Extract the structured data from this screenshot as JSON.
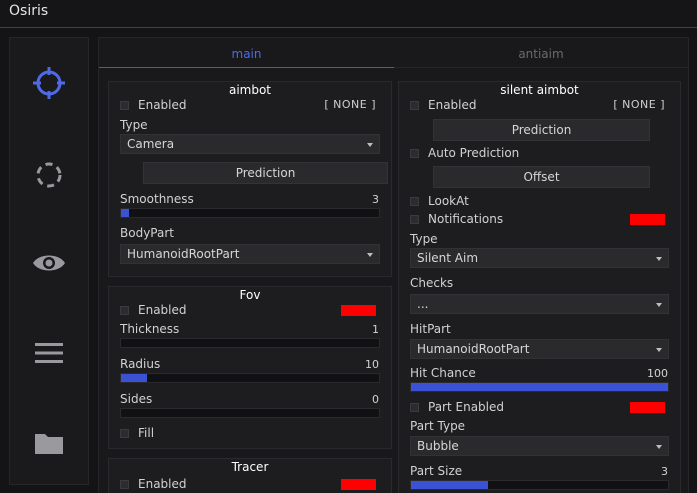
{
  "app": {
    "title": "Osiris"
  },
  "sidebar": {
    "items": [
      {
        "name": "aimbot",
        "icon": "crosshair-icon",
        "active": true
      },
      {
        "name": "loading",
        "icon": "loading-spinner-icon"
      },
      {
        "name": "visuals",
        "icon": "eye-icon"
      },
      {
        "name": "misc",
        "icon": "menu-icon"
      },
      {
        "name": "configs",
        "icon": "folder-icon"
      }
    ],
    "active_color": "#4e6ae6",
    "icon_color": "#9a9a9e"
  },
  "tabs": [
    {
      "label": "main",
      "active": true
    },
    {
      "label": "antiaim",
      "active": false
    }
  ],
  "aimbot": {
    "title": "aimbot",
    "enabled_label": "Enabled",
    "keybind": "[ NONE ]",
    "type_label": "Type",
    "type_value": "Camera",
    "prediction_button": "Prediction",
    "smoothness_label": "Smoothness",
    "smoothness_value": "3",
    "smoothness_fraction": 0.03,
    "bodypart_label": "BodyPart",
    "bodypart_value": "HumanoidRootPart"
  },
  "fov": {
    "title": "Fov",
    "enabled_label": "Enabled",
    "color": "#ff0000",
    "thickness_label": "Thickness",
    "thickness_value": "1",
    "thickness_fraction": 0.0,
    "radius_label": "Radius",
    "radius_value": "10",
    "radius_fraction": 0.1,
    "sides_label": "Sides",
    "sides_value": "0",
    "sides_fraction": 0.0,
    "fill_label": "Fill"
  },
  "tracer": {
    "title": "Tracer",
    "enabled_label": "Enabled",
    "color": "#ff0000"
  },
  "silent": {
    "title": "silent aimbot",
    "enabled_label": "Enabled",
    "keybind": "[ NONE ]",
    "prediction_button": "Prediction",
    "auto_prediction_label": "Auto Prediction",
    "offset_button": "Offset",
    "lookat_label": "LookAt",
    "notifications_label": "Notifications",
    "notifications_color": "#ff0000",
    "type_label": "Type",
    "type_value": "Silent Aim",
    "checks_label": "Checks",
    "checks_value": "...",
    "hitpart_label": "HitPart",
    "hitpart_value": "HumanoidRootPart",
    "hitchance_label": "Hit Chance",
    "hitchance_value": "100",
    "hitchance_fraction": 1.0,
    "part_enabled_label": "Part Enabled",
    "part_enabled_color": "#ff0000",
    "part_type_label": "Part Type",
    "part_type_value": "Bubble",
    "part_size_label": "Part Size",
    "part_size_value": "3",
    "part_size_fraction": 0.3
  }
}
